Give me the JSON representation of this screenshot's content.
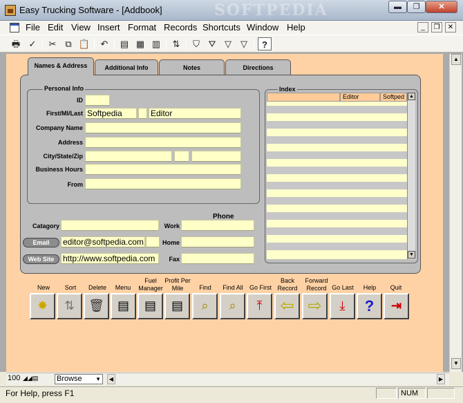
{
  "window": {
    "title": "Easy Trucking Software - [Addbook]",
    "watermark": "SOFTPEDIA",
    "min_glyph": "▬",
    "max_glyph": "❐",
    "close_glyph": "✕"
  },
  "menu": {
    "items": [
      "File",
      "Edit",
      "View",
      "Insert",
      "Format",
      "Records",
      "Shortcuts",
      "Window",
      "Help"
    ],
    "mdi_min": "_",
    "mdi_restore": "❐",
    "mdi_close": "✕"
  },
  "toolbar": {
    "icons": [
      "printer-icon",
      "spellcheck-icon",
      "cut-icon",
      "copy-icon",
      "paste-icon",
      "undo-icon",
      "form-icon",
      "table-icon",
      "datasheet-icon",
      "sort-icon",
      "filter-icon",
      "filter-form-icon",
      "apply-filter-icon",
      "help-icon"
    ],
    "glyphs": [
      "🖶",
      "✓",
      "✂",
      "⧉",
      "📋",
      "↶",
      "▤",
      "▦",
      "▥",
      "⇅",
      "⛉",
      "⛛",
      "▽",
      "?"
    ]
  },
  "tabs": [
    {
      "label": "Names & Address",
      "active": true
    },
    {
      "label": "Additional Info",
      "active": false
    },
    {
      "label": "Notes",
      "active": false
    },
    {
      "label": "Directions",
      "active": false
    }
  ],
  "personal": {
    "group_label": "Personal Info",
    "id_label": "ID",
    "id_value": "",
    "name_label": "First/MI/Last",
    "first": "Softpedia",
    "mi": "",
    "last": "Editor",
    "company_label": "Company Name",
    "company": "",
    "address_label": "Address",
    "address": "",
    "csz_label": "City/State/Zip",
    "city": "",
    "state": "",
    "zip": "",
    "hours_label": "Business Hours",
    "hours": "",
    "from_label": "From",
    "from": ""
  },
  "contact": {
    "category_label": "Catagory",
    "category": "",
    "email_button": "Email",
    "email": "editor@softpedia.com",
    "website_button": "Web Site",
    "website": "http://www.softpedia.com",
    "phone_header": "Phone",
    "work_label": "Work",
    "work": "",
    "home_label": "Home",
    "home": "",
    "fax_label": "Fax",
    "fax": ""
  },
  "index": {
    "group_label": "Index",
    "columns": [
      "",
      "Editor",
      "Softped"
    ],
    "up_arrow": "▲",
    "down_arrow": "▼"
  },
  "actions": [
    {
      "label": "New",
      "icon": "new-record-icon",
      "glyph": "✸"
    },
    {
      "label": "Sort",
      "icon": "sort-icon",
      "glyph": "⇅"
    },
    {
      "label": "Delete",
      "icon": "trash-icon",
      "glyph": "🗑"
    },
    {
      "label": "Menu",
      "icon": "menu-document-icon",
      "glyph": "▤"
    },
    {
      "label": "Fuel Manager",
      "icon": "fuel-document-icon",
      "glyph": "▤"
    },
    {
      "label": "Profit Per Mile",
      "icon": "profit-document-icon",
      "glyph": "▤"
    },
    {
      "label": "Find",
      "icon": "find-icon",
      "glyph": "⌕"
    },
    {
      "label": "Find All",
      "icon": "find-all-icon",
      "glyph": "⌕"
    },
    {
      "label": "Go First",
      "icon": "go-first-icon",
      "glyph": "⤒"
    },
    {
      "label": "Back Record",
      "icon": "back-arrow-icon",
      "glyph": "⇦"
    },
    {
      "label": "Forward Record",
      "icon": "forward-arrow-icon",
      "glyph": "⇨"
    },
    {
      "label": "Go Last",
      "icon": "go-last-icon",
      "glyph": "⤓"
    },
    {
      "label": "Help",
      "icon": "help-icon",
      "glyph": "?"
    },
    {
      "label": "Quit",
      "icon": "exit-door-icon",
      "glyph": "⇥"
    }
  ],
  "bottom": {
    "zoom": "100",
    "mode": "Browse",
    "status": "For Help, press F1",
    "num": "NUM"
  },
  "colors": {
    "form_bg": "#ffd2a6",
    "panel": "#bdbdbd",
    "field": "#ffffc8",
    "index_header": "#ffcc99"
  }
}
